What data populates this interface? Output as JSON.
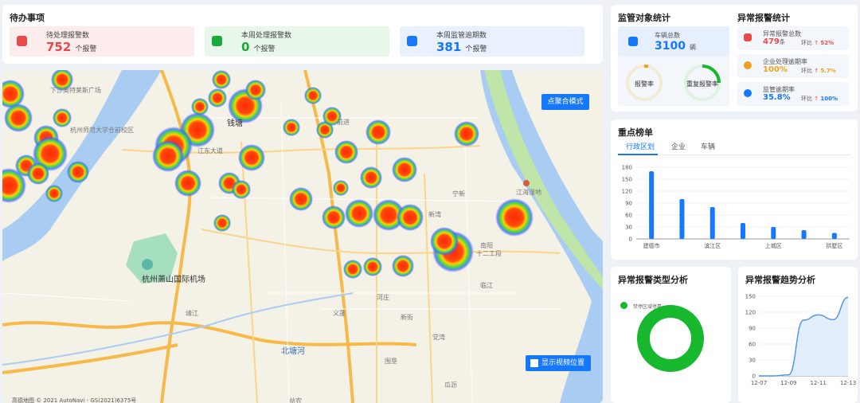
{
  "todo": {
    "title": "待办事项",
    "items": [
      {
        "label": "待处理报警数",
        "value": "752",
        "unit": "个报警",
        "color": "#e84a4a",
        "bg": "#fdecec"
      },
      {
        "label": "本周处理报警数",
        "value": "0",
        "unit": "个报警",
        "color": "#1aaa3a",
        "bg": "#e7f7ea"
      },
      {
        "label": "本周监管逾期数",
        "value": "381",
        "unit": "个报警",
        "color": "#1677ff",
        "bg": "#e8f1fd"
      }
    ]
  },
  "map": {
    "button_aggregate": "点聚合模式",
    "button_video": "显示视频位置",
    "copyright": "高德地图 © 2021 AutoNavi - GS(2021)6375号",
    "labels": [
      "下沙奥特莱斯广场",
      "杭州师范大学仓前校区",
      "钱塘",
      "江东大道",
      "杭州萧山国际机场",
      "北塘河",
      "江海湿地",
      "宁新",
      "新湾",
      "前进",
      "义蓬",
      "南阳",
      "瓜沥",
      "靖江",
      "党湾",
      "益农",
      "新街",
      "河庄",
      "临江",
      "十二工段",
      "围垦"
    ]
  },
  "monitor": {
    "title": "监管对象统计",
    "vehicle_label": "车辆总数",
    "vehicle_value": "3100",
    "vehicle_unit": "辆",
    "ring1_label": "报警率",
    "ring2_label": "重复报警率"
  },
  "abnormal": {
    "title": "异常报警统计",
    "rows": [
      {
        "label": "异常报警总数",
        "value": "479",
        "unit": "条",
        "ratio_label": "环比",
        "ratio": "52%",
        "value_color": "#e84a4a",
        "icon_color": "#e84a4a"
      },
      {
        "label": "企业处理逾期率",
        "value": "100%",
        "unit": "",
        "ratio_label": "环比",
        "ratio": "5.7%",
        "value_color": "#f0a020",
        "icon_color": "#f0a020"
      },
      {
        "label": "监管逾期率",
        "value": "35.8%",
        "unit": "",
        "ratio_label": "环比",
        "ratio": "100%",
        "value_color": "#1677ff",
        "icon_color": "#1677ff"
      }
    ]
  },
  "ranking": {
    "title": "重点榜单",
    "tabs": [
      "行政区划",
      "企业",
      "车辆"
    ]
  },
  "types": {
    "title": "异常报警类型分析",
    "legend": "禁停区域停靠"
  },
  "trend": {
    "title": "异常报警趋势分析"
  },
  "colors": {
    "accent": "#1677ff",
    "green": "#18b82e",
    "red": "#e84a4a",
    "orange": "#f0a020"
  },
  "chart_data": [
    {
      "type": "bar",
      "categories": [
        "建德市",
        "",
        "滨江区",
        "",
        "上城区",
        "",
        "拱墅区"
      ],
      "values": [
        170,
        100,
        80,
        40,
        30,
        22,
        15
      ],
      "ylim": [
        0,
        180
      ],
      "yticks": [
        0,
        30,
        60,
        90,
        120,
        150,
        180
      ]
    },
    {
      "type": "pie",
      "legend": [
        "禁停区域停靠"
      ],
      "values": [
        100
      ]
    },
    {
      "type": "area",
      "x_ticks": [
        "12-07",
        "12-09",
        "12-11",
        "12-13"
      ],
      "x": [
        "12-07",
        "12-08",
        "12-09",
        "12-10",
        "12-11",
        "12-12",
        "12-13"
      ],
      "values": [
        0,
        0,
        2,
        105,
        115,
        106,
        148
      ],
      "ylim": [
        0,
        150
      ],
      "yticks": [
        0,
        30,
        60,
        90,
        120,
        150
      ]
    }
  ]
}
